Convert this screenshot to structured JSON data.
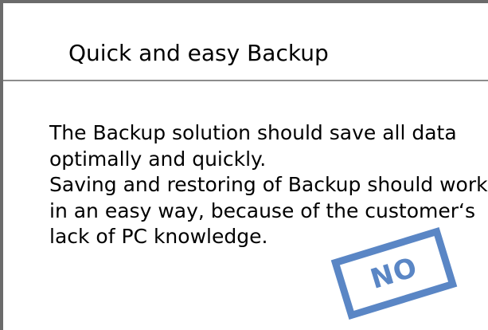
{
  "slide": {
    "title": "Quick and easy Backup",
    "body_lines": [
      "The Backup solution should save all data",
      "optimally and quickly.",
      "Saving and restoring of Backup should work",
      "in an easy way, because of the customer‘s",
      "lack of PC knowledge."
    ],
    "stamp_label": "NO"
  },
  "colors": {
    "frame": "#6b6b6b",
    "divider": "#8c8c8c",
    "stamp": "#5a86c5",
    "text": "#000000",
    "background": "#ffffff"
  }
}
